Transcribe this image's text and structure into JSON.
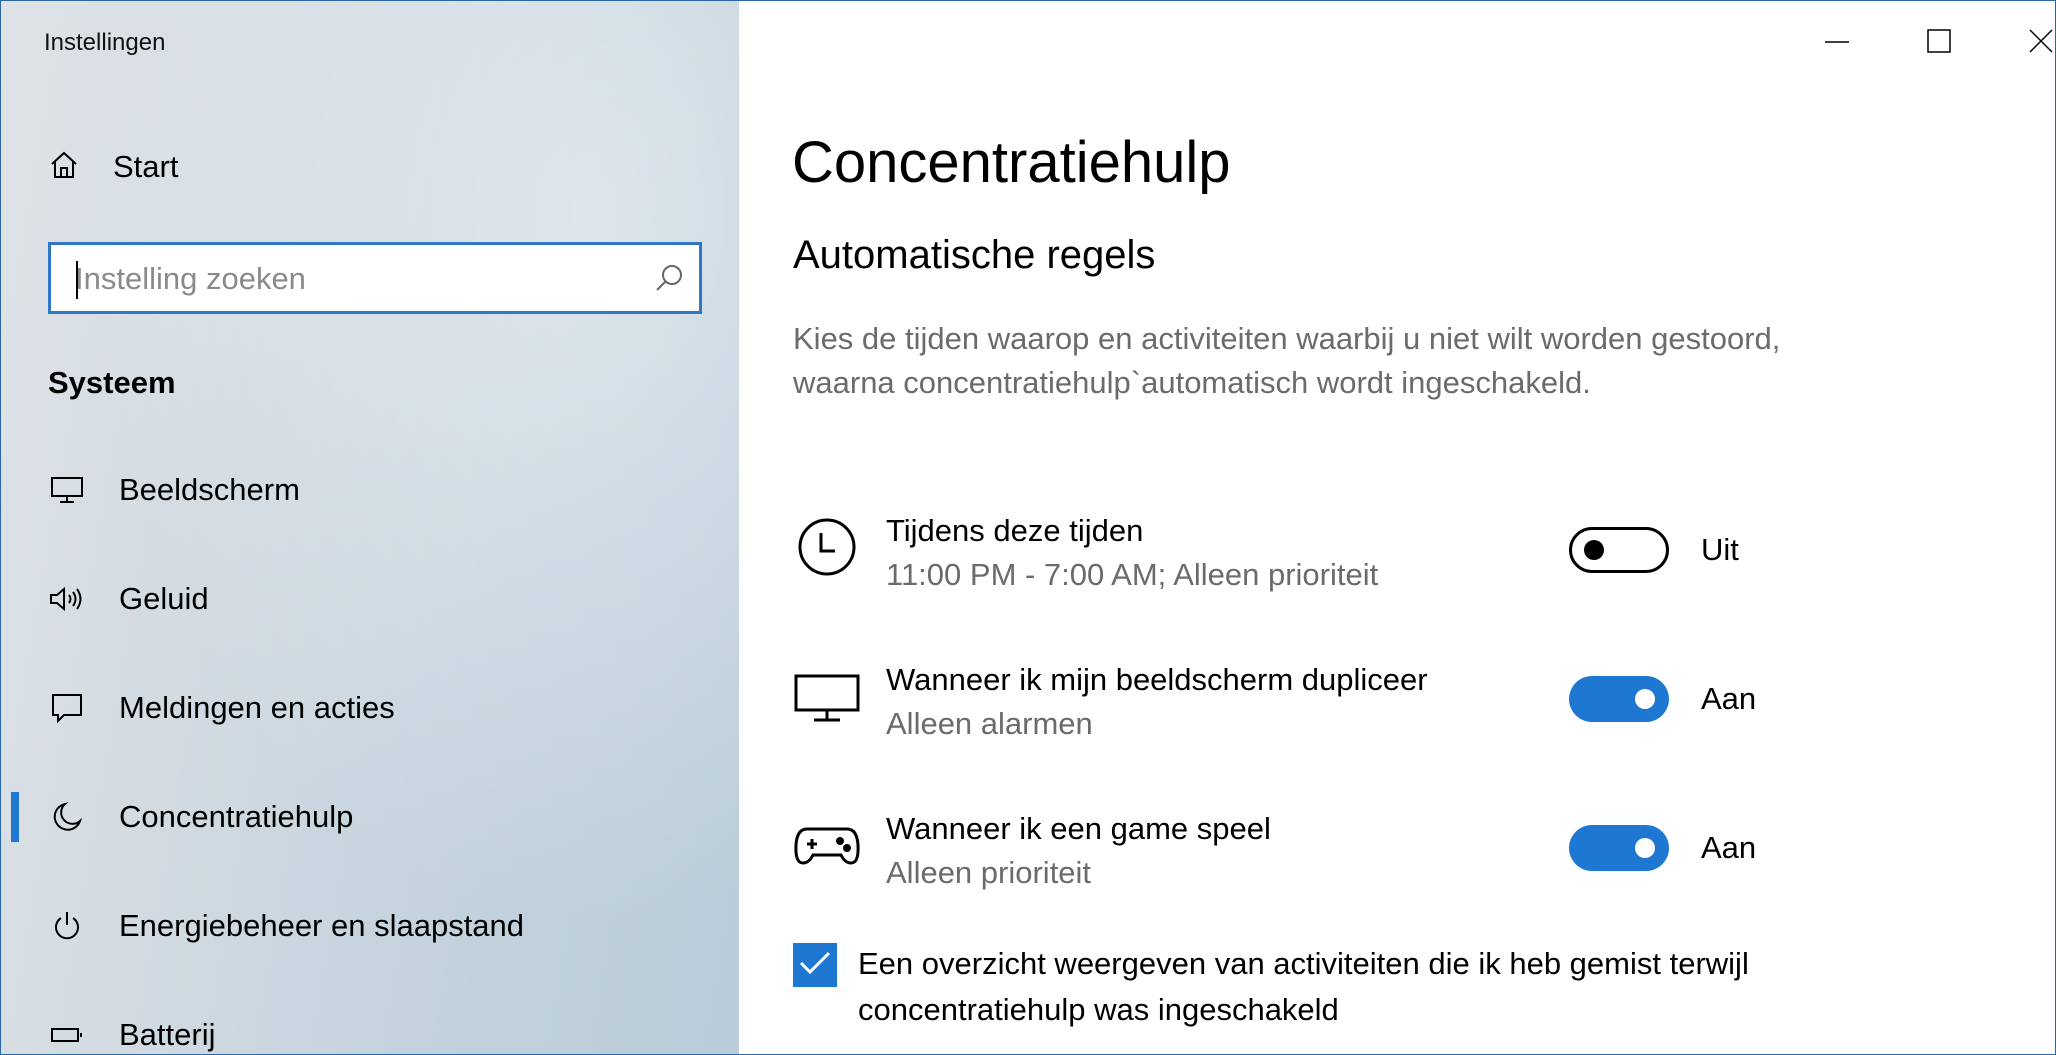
{
  "window": {
    "app_title": "Instellingen",
    "controls": {
      "minimize_icon": "minimize-icon",
      "maximize_icon": "maximize-icon",
      "close_icon": "close-icon"
    }
  },
  "sidebar": {
    "home": {
      "label": "Start",
      "icon": "home-icon"
    },
    "search": {
      "placeholder": "Instelling zoeken",
      "value": "",
      "icon": "search-icon"
    },
    "section_title": "Systeem",
    "items": [
      {
        "label": "Beeldscherm",
        "icon": "display-icon",
        "active": false
      },
      {
        "label": "Geluid",
        "icon": "speaker-icon",
        "active": false
      },
      {
        "label": "Meldingen en acties",
        "icon": "notification-icon",
        "active": false
      },
      {
        "label": "Concentratiehulp",
        "icon": "moon-icon",
        "active": true
      },
      {
        "label": "Energiebeheer en slaapstand",
        "icon": "power-icon",
        "active": false
      },
      {
        "label": "Batterij",
        "icon": "battery-icon",
        "active": false
      }
    ]
  },
  "main": {
    "page_title": "Concentratiehulp",
    "section_title": "Automatische regels",
    "description": "Kies de tijden waarop en activiteiten waarbij u niet wilt worden gestoord, waarna concentratiehulp`automatisch wordt ingeschakeld.",
    "rules": [
      {
        "title": "Tijdens deze tijden",
        "detail": "11:00 PM - 7:00 AM; Alleen prioriteit",
        "icon": "clock-icon",
        "on": false,
        "state_label": "Uit"
      },
      {
        "title": "Wanneer ik mijn beeldscherm dupliceer",
        "detail": "Alleen alarmen",
        "icon": "monitor-icon",
        "on": true,
        "state_label": "Aan"
      },
      {
        "title": "Wanneer ik een game speel",
        "detail": "Alleen prioriteit",
        "icon": "gamepad-icon",
        "on": true,
        "state_label": "Aan"
      }
    ],
    "summary_checkbox": {
      "checked": true,
      "label": "Een overzicht weergeven van activiteiten die ik heb gemist terwijl concentratiehulp was ingeschakeld"
    }
  },
  "colors": {
    "accent": "#1e78d2",
    "search_border": "#2f78c4",
    "secondary_text": "#6b6b6b"
  }
}
